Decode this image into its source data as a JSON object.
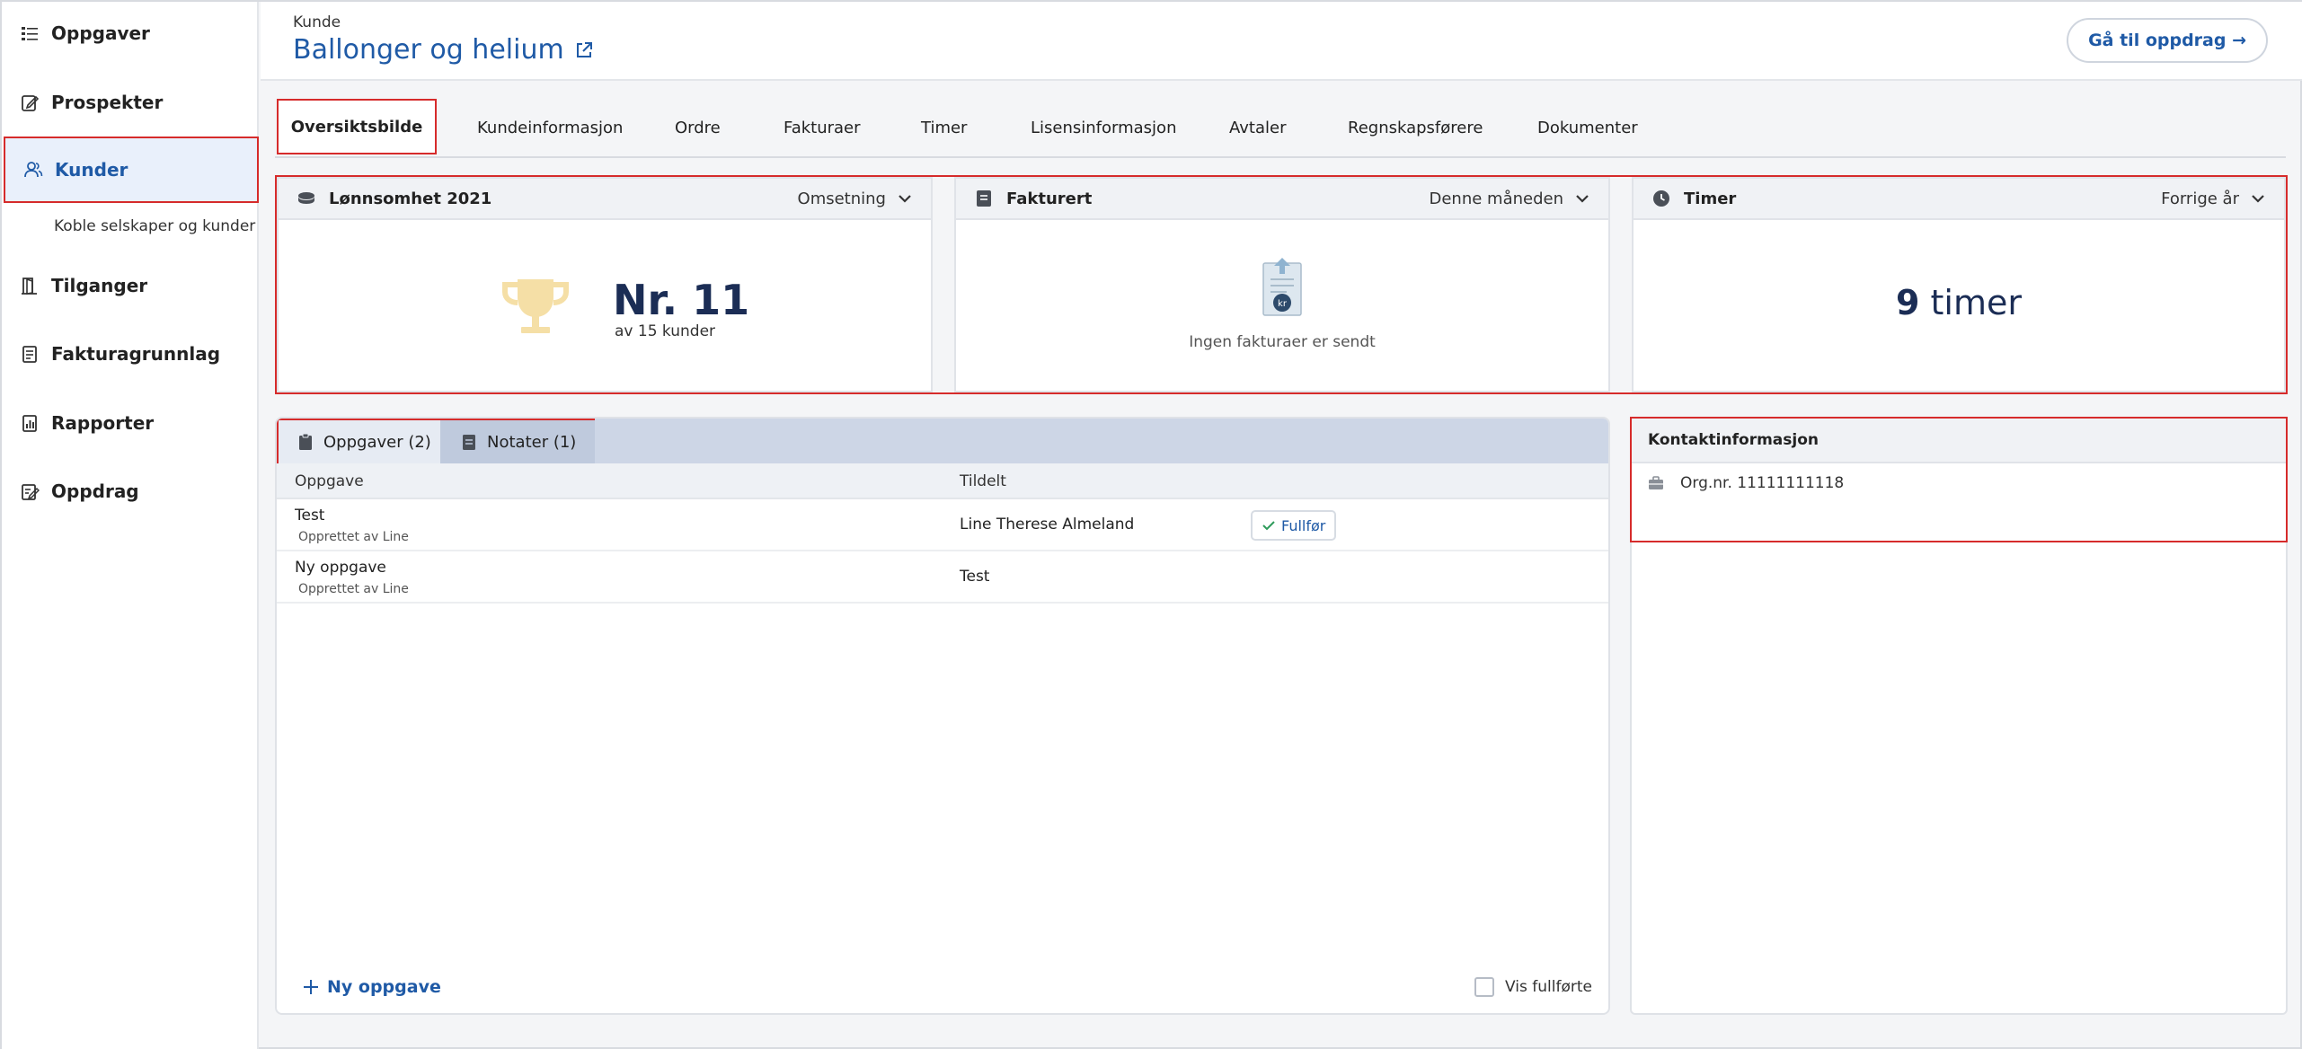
{
  "sidebar": {
    "items": [
      {
        "label": "Oppgaver",
        "icon": "tasks-list-icon"
      },
      {
        "label": "Prospekter",
        "icon": "prospect-edit-icon"
      },
      {
        "label": "Kunder",
        "icon": "users-icon"
      },
      {
        "label": "Tilganger",
        "icon": "door-access-icon"
      },
      {
        "label": "Fakturagrunnlag",
        "icon": "invoice-doc-icon"
      },
      {
        "label": "Rapporter",
        "icon": "report-chart-icon"
      },
      {
        "label": "Oppdrag",
        "icon": "assignment-edit-icon"
      }
    ],
    "sub_item": "Koble selskaper og kunder"
  },
  "header": {
    "breadcrumb": "Kunde",
    "title": "Ballonger og helium",
    "goto_button": "Gå til oppdrag →"
  },
  "tabs": [
    "Oversiktsbilde",
    "Kundeinformasjon",
    "Ordre",
    "Fakturaer",
    "Timer",
    "Lisensinformasjon",
    "Avtaler",
    "Regnskapsførere",
    "Dokumenter"
  ],
  "cards": {
    "profit": {
      "title": "Lønnsomhet 2021",
      "select": "Omsetning",
      "rank": "Nr. 11",
      "rank_sub": "av 15 kunder"
    },
    "invoiced": {
      "title": "Fakturert",
      "select": "Denne måneden",
      "empty": "Ingen fakturaer er sendt"
    },
    "hours": {
      "title": "Timer",
      "select": "Forrige år",
      "value": "9",
      "unit": " timer"
    }
  },
  "tasks": {
    "tab_tasks": "Oppgaver (2)",
    "tab_notes": "Notater (1)",
    "col_task": "Oppgave",
    "col_assigned": "Tildelt",
    "rows": [
      {
        "title": "Test",
        "created": "Opprettet av Line",
        "assigned": "Line Therese Almeland",
        "action": "Fullfør"
      },
      {
        "title": "Ny oppgave",
        "created": "Opprettet av Line",
        "assigned": "Test"
      }
    ],
    "new_task": "Ny oppgave",
    "show_done": "Vis fullførte"
  },
  "contact": {
    "title": "Kontaktinformasjon",
    "org": "Org.nr. 11111111118"
  },
  "colors": {
    "accent": "#1f5aa6",
    "highlight_border": "#d62b2b",
    "dark_text": "#1b2d55"
  }
}
